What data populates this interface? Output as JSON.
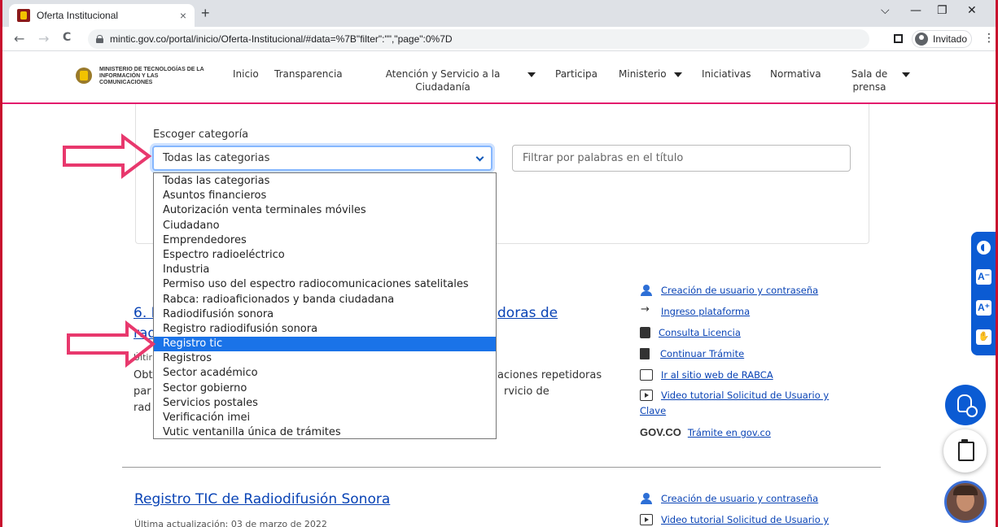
{
  "browser": {
    "tab_title": "Oferta Institucional",
    "tab_close": "×",
    "new_tab": "+",
    "url": "mintic.gov.co/portal/inicio/Oferta-Institucional/#data=%7B\"filter\":\"\",\"page\":0%7D",
    "profile_label": "Invitado",
    "back": "←",
    "forward": "→",
    "reload": "C",
    "minimize": "—",
    "maximize": "❐",
    "close": "✕",
    "dropdown_tabs": "⌵",
    "menu": "⋮"
  },
  "header": {
    "logo_text": "MINISTERIO DE TECNOLOGÍAS DE LA INFORMACIÓN Y LAS COMUNICACIONES",
    "nav": {
      "inicio": "Inicio",
      "transparencia": "Transparencia",
      "atencion": "Atención y Servicio a la Ciudadanía",
      "participa": "Participa",
      "ministerio": "Ministerio",
      "iniciativas": "Iniciativas",
      "normativa": "Normativa",
      "sala": "Sala de prensa"
    }
  },
  "filter": {
    "category_label": "Escoger categoría",
    "selected_category": "Todas las categorias",
    "search_placeholder": "Filtrar por palabras en el título",
    "options": [
      "Todas las categorias",
      "Asuntos financieros",
      "Autorización venta terminales móviles",
      "Ciudadano",
      "Emprendedores",
      "Espectro radioeléctrico",
      "Industria",
      "Permiso uso del espectro radiocomunicaciones satelitales",
      "Rabca: radioaficionados y banda ciudadana",
      "Radiodifusión sonora",
      "Registro radiodifusión sonora",
      "Registro tic",
      "Registros",
      "Sector académico",
      "Sector gobierno",
      "Servicios postales",
      "Verificación imei",
      "Vutic ventanilla única de trámites"
    ],
    "highlighted_option": "Registro tic"
  },
  "result1": {
    "title_left": "6. I",
    "title_right": "doras de",
    "title_line2": "rad",
    "meta_frag": "Últir",
    "body_l1_left": "Obt",
    "body_l1_right": "aciones repetidoras",
    "body_l2_left": "par",
    "body_l2_right": "rvicio de",
    "body_l3_left": "rad",
    "links": {
      "create_user": "Creación de usuario y contraseña",
      "login": "Ingreso plataforma",
      "license": "Consulta Licencia",
      "continue": "Continuar Trámite",
      "rabca": "Ir al sitio web de RABCA",
      "video_l1": "Video tutorial Solicitud de Usuario y",
      "video_l2": "Clave",
      "govco_logo": "GOV.CO",
      "govco_link": "Trámite en gov.co"
    }
  },
  "result2": {
    "title": "Registro TIC de Radiodifusión Sonora",
    "meta": "Última actualización: 03 de marzo de 2022",
    "links": {
      "create_user": "Creación de usuario y contraseña",
      "video": "Video tutorial Solicitud de Usuario y"
    }
  },
  "accessibility": {
    "decrease": "A⁻",
    "increase": "A⁺",
    "sign": "✋"
  },
  "colors": {
    "accent_pink": "#e31b6c",
    "link_blue": "#0943b5",
    "select_highlight": "#1a73e8",
    "a11y_blue": "#0b5bd3",
    "arrow": "#e8386d"
  }
}
